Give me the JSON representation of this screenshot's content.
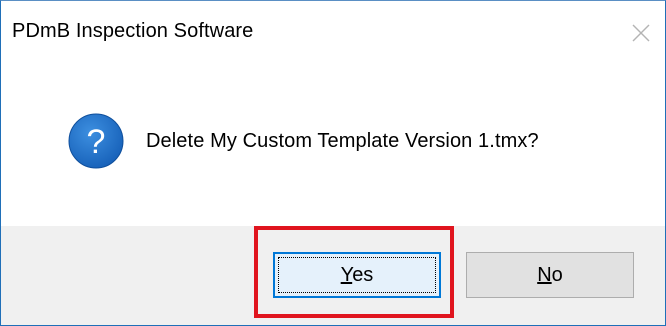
{
  "window": {
    "title": "PDmB Inspection Software",
    "close_icon": "close-icon"
  },
  "dialog": {
    "icon": "question-icon",
    "icon_glyph": "?",
    "message": "Delete My Custom Template Version 1.tmx?"
  },
  "buttons": {
    "yes": {
      "accel": "Y",
      "rest": "es"
    },
    "no": {
      "accel": "N",
      "rest": "o"
    }
  },
  "colors": {
    "question_icon": "#1a6fc7",
    "highlight": "#e0141e",
    "focus_border": "#0078d7"
  }
}
